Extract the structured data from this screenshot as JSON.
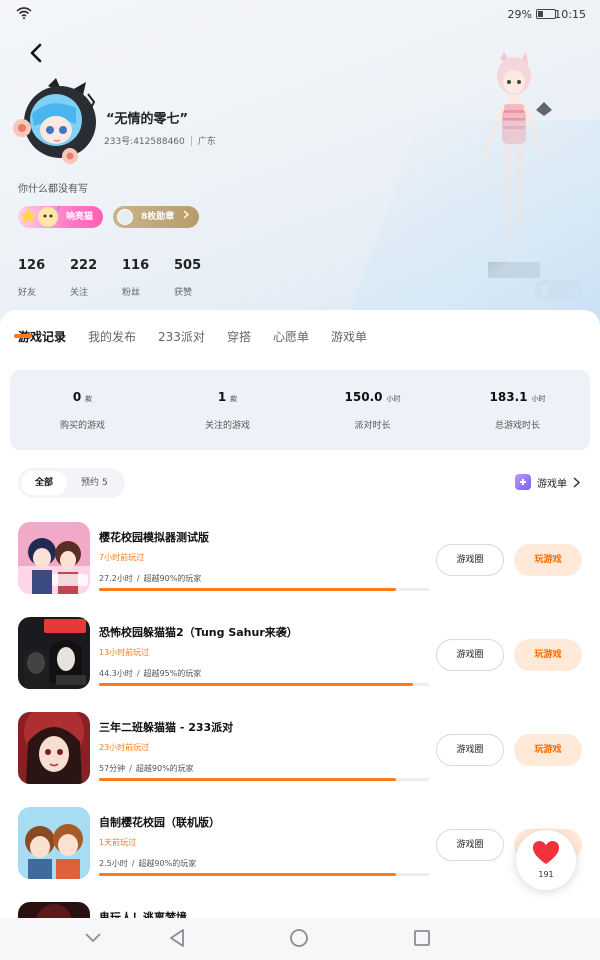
{
  "status_bar": {
    "battery": "29%",
    "time": "10:15"
  },
  "profile": {
    "name": "“无情的零七”",
    "id_text": "233号:412588460",
    "region": "广东",
    "bio": "你什么都没有写",
    "level_badge": "响亮猫",
    "medal_badge": "8枚勋章",
    "stats": [
      {
        "value": "126",
        "label": "好友"
      },
      {
        "value": "222",
        "label": "关注"
      },
      {
        "value": "116",
        "label": "粉丝"
      },
      {
        "value": "505",
        "label": "获赞"
      }
    ],
    "outfit_button": "换衣服"
  },
  "tabs": [
    "游戏记录",
    "我的发布",
    "233派对",
    "穿搭",
    "心愿单",
    "游戏单"
  ],
  "summary": [
    {
      "value": "0",
      "unit": "款",
      "label": "购买的游戏"
    },
    {
      "value": "1",
      "unit": "款",
      "label": "关注的游戏"
    },
    {
      "value": "150.0",
      "unit": "小时",
      "label": "派对时长"
    },
    {
      "value": "183.1",
      "unit": "小时",
      "label": "总游戏时长"
    }
  ],
  "filters": {
    "all": "全部",
    "reserve": "预约",
    "reserve_count": "5",
    "list_link": "游戏单"
  },
  "games": [
    {
      "title": "樱花校园模拟器测试版",
      "last_played": "7小时前玩过",
      "duration": "27.2小时",
      "rank": "超越90%的玩家",
      "progress": 0.9,
      "circle_btn": "游戏圈",
      "play_btn": "玩游戏"
    },
    {
      "title": "恐怖校园躲猫猫2（Tung Sahur来袭）",
      "last_played": "13小时前玩过",
      "duration": "44.3小时",
      "rank": "超越95%的玩家",
      "progress": 0.95,
      "circle_btn": "游戏圈",
      "play_btn": "玩游戏"
    },
    {
      "title": "三年二班躲猫猫 - 233派对",
      "last_played": "23小时前玩过",
      "duration": "57分钟",
      "rank": "超越90%的玩家",
      "progress": 0.9,
      "circle_btn": "游戏圈",
      "play_btn": "玩游戏"
    },
    {
      "title": "自制樱花校园（联机版）",
      "last_played": "1天前玩过",
      "duration": "2.5小时",
      "rank": "超越90%的玩家",
      "progress": 0.9,
      "circle_btn": "游戏圈",
      "play_btn": "玩游戏"
    },
    {
      "title": "鬼玩人！逃离梦境"
    }
  ],
  "like_fab": {
    "count": "191"
  },
  "colors": {
    "accent": "#ff7a1a",
    "play_bg": "#ffe9d9",
    "summary_bg": "#eef2f8",
    "heart": "#f0323c"
  }
}
